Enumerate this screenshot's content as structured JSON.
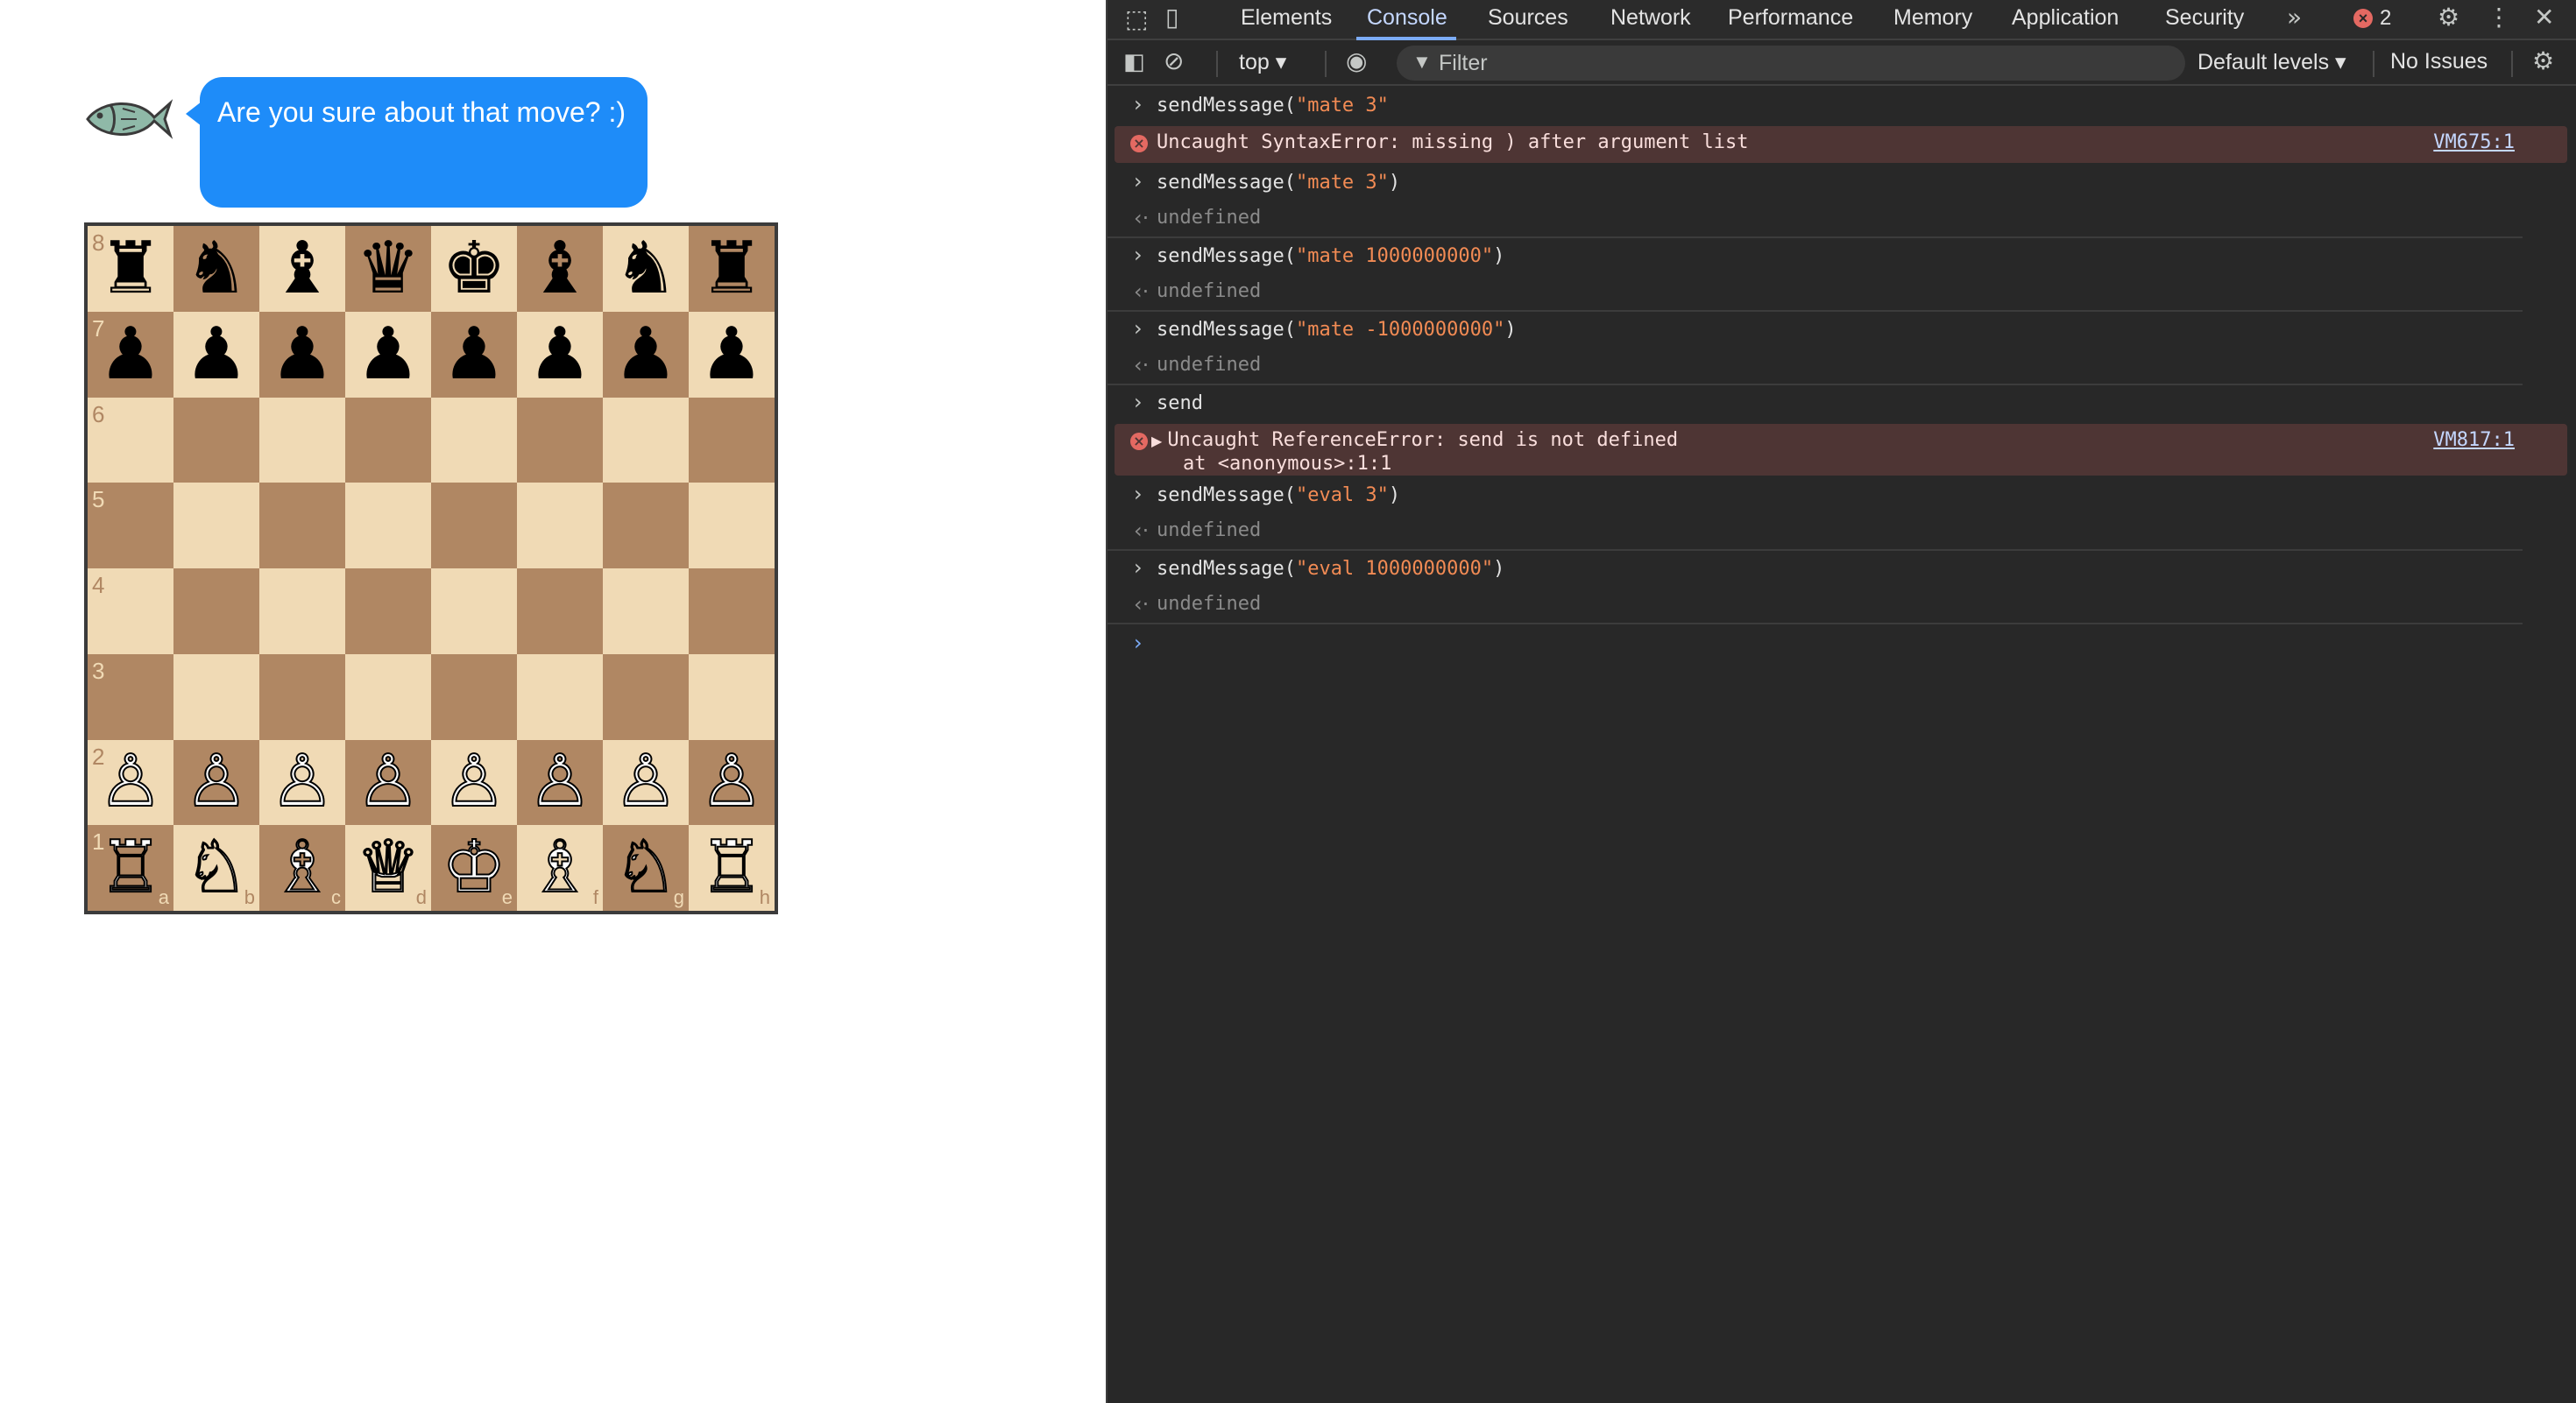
{
  "chat": {
    "avatar_icon": "fish-icon",
    "message": "Are you sure about that move? :)",
    "bubble_color": "#1e8cf9"
  },
  "board": {
    "light_color": "#f0dab5",
    "dark_color": "#b08763",
    "ranks": [
      "8",
      "7",
      "6",
      "5",
      "4",
      "3",
      "2",
      "1"
    ],
    "files": [
      "a",
      "b",
      "c",
      "d",
      "e",
      "f",
      "g",
      "h"
    ],
    "rows": [
      [
        "♜",
        "♞",
        "♝",
        "♛",
        "♚",
        "♝",
        "♞",
        "♜"
      ],
      [
        "♟",
        "♟",
        "♟",
        "♟",
        "♟",
        "♟",
        "♟",
        "♟"
      ],
      [
        "",
        "",
        "",
        "",
        "",
        "",
        "",
        ""
      ],
      [
        "",
        "",
        "",
        "",
        "",
        "",
        "",
        ""
      ],
      [
        "",
        "",
        "",
        "",
        "",
        "",
        "",
        ""
      ],
      [
        "",
        "",
        "",
        "",
        "",
        "",
        "",
        ""
      ],
      [
        "♙",
        "♙",
        "♙",
        "♙",
        "♙",
        "♙",
        "♙",
        "♙"
      ],
      [
        "♖",
        "♘",
        "♗",
        "♕",
        "♔",
        "♗",
        "♘",
        "♖"
      ]
    ]
  },
  "devtools": {
    "tabs": [
      "Elements",
      "Console",
      "Sources",
      "Network",
      "Performance",
      "Memory",
      "Application",
      "Security"
    ],
    "active_tab": "Console",
    "more_tabs_icon": "double-chevron-right-icon",
    "error_count": "2",
    "toolbar": {
      "context": "top ▾",
      "filter_placeholder": "Filter",
      "levels": "Default levels ▾",
      "issues": "No Issues"
    },
    "console": [
      {
        "type": "input",
        "prefix": "sendMessage(",
        "str": "\"mate 3\"",
        "suffix": ""
      },
      {
        "type": "error",
        "text": "Uncaught SyntaxError: missing ) after argument list",
        "link": "VM675:1"
      },
      {
        "type": "input",
        "prefix": "sendMessage(",
        "str": "\"mate 3\"",
        "suffix": ")"
      },
      {
        "type": "output",
        "text": "undefined"
      },
      {
        "type": "input",
        "prefix": "sendMessage(",
        "str": "\"mate 1000000000\"",
        "suffix": ")"
      },
      {
        "type": "output",
        "text": "undefined"
      },
      {
        "type": "input",
        "prefix": "sendMessage(",
        "str": "\"mate -1000000000\"",
        "suffix": ")"
      },
      {
        "type": "output",
        "text": "undefined"
      },
      {
        "type": "input",
        "prefix": "send",
        "str": "",
        "suffix": ""
      },
      {
        "type": "error2",
        "text": "Uncaught ReferenceError: send is not defined",
        "text2": "at <anonymous>:1:1",
        "link": "VM817:1"
      },
      {
        "type": "input",
        "prefix": "sendMessage(",
        "str": "\"eval 3\"",
        "suffix": ")"
      },
      {
        "type": "output",
        "text": "undefined"
      },
      {
        "type": "input",
        "prefix": "sendMessage(",
        "str": "\"eval 1000000000\"",
        "suffix": ")"
      },
      {
        "type": "output",
        "text": "undefined"
      }
    ]
  }
}
